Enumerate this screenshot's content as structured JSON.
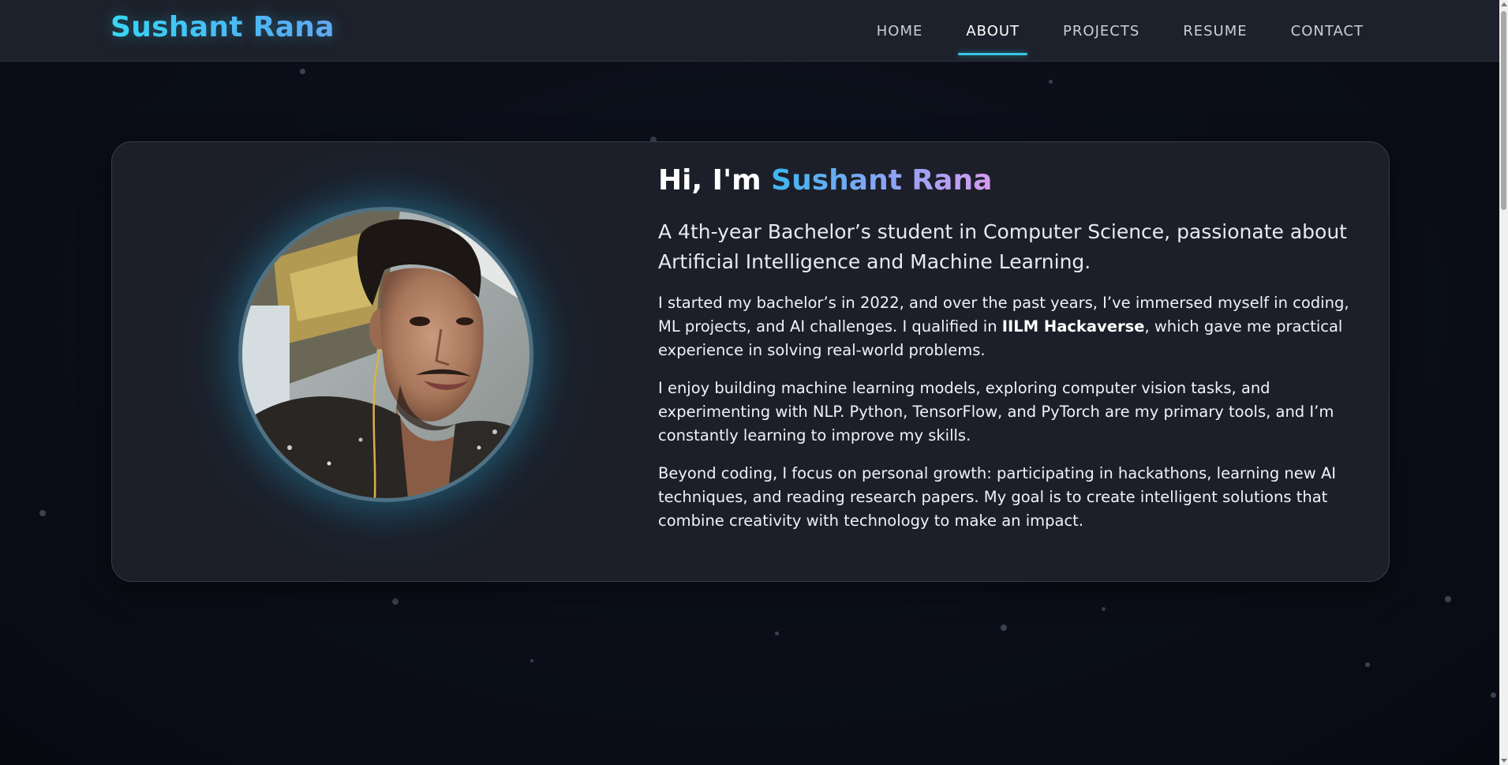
{
  "header": {
    "brand": "Sushant Rana",
    "nav": [
      {
        "label": "HOME",
        "active": false
      },
      {
        "label": "ABOUT",
        "active": true
      },
      {
        "label": "PROJECTS",
        "active": false
      },
      {
        "label": "RESUME",
        "active": false
      },
      {
        "label": "CONTACT",
        "active": false
      }
    ]
  },
  "about": {
    "greeting": "Hi, I'm",
    "name": "Sushant Rana",
    "lead": "A 4th-year Bachelor’s student in Computer Science, passionate about Artificial Intelligence and Machine Learning.",
    "para1_before": "I started my bachelor’s in 2022, and over the past years, I’ve immersed myself in coding, ML projects, and AI challenges. I qualified in ",
    "para1_bold": "IILM Hackaverse",
    "para1_after": ", which gave me practical experience in solving real-world problems.",
    "para2": "I enjoy building machine learning models, exploring computer vision tasks, and experimenting with NLP. Python, TensorFlow, and PyTorch are my primary tools, and I’m constantly learning to improve my skills.",
    "para3": "Beyond coding, I focus on personal growth: participating in hackathons, learning new AI techniques, and reading research papers. My goal is to create intelligent solutions that combine creativity with technology to make an impact.",
    "avatar_icon": "profile-photo"
  },
  "colors": {
    "accent": "#39c7e8",
    "brand_gradient_start": "#3ad8f5",
    "name_gradient_end": "#d49bf0",
    "card_bg": "#1c1f29",
    "page_bg": "#0b0e17"
  }
}
